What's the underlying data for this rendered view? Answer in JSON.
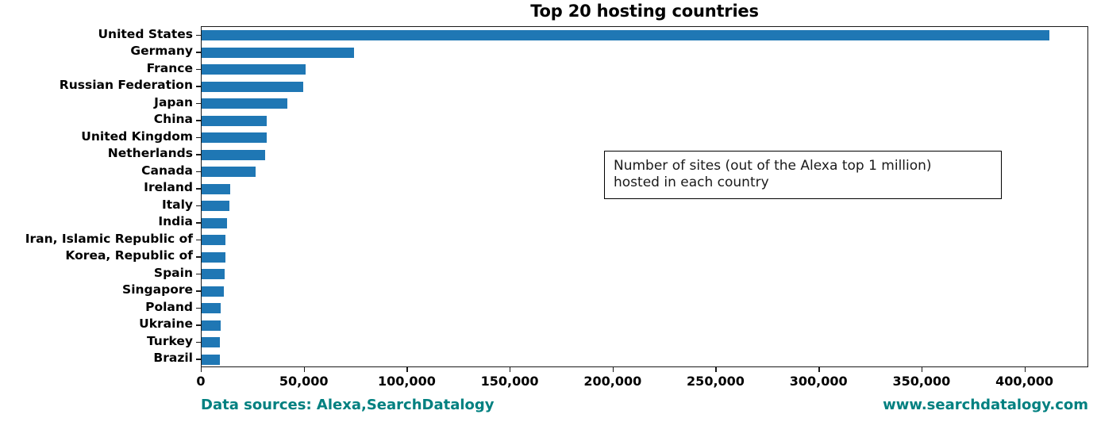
{
  "chart_data": {
    "type": "bar",
    "orientation": "horizontal",
    "title": "Top 20 hosting countries",
    "xlabel": "",
    "ylabel": "",
    "xlim": [
      0,
      431000
    ],
    "grid": false,
    "legend": null,
    "categories": [
      "United States",
      "Germany",
      "France",
      "Russian Federation",
      "Japan",
      "China",
      "United Kingdom",
      "Netherlands",
      "Canada",
      "Ireland",
      "Italy",
      "India",
      "Iran, Islamic Republic of",
      "Korea, Republic of",
      "Spain",
      "Singapore",
      "Poland",
      "Ukraine",
      "Turkey",
      "Brazil"
    ],
    "values": [
      411600,
      74000,
      50500,
      49300,
      41700,
      31600,
      31600,
      30800,
      26200,
      13900,
      13500,
      12300,
      11600,
      11600,
      11200,
      10800,
      9400,
      9300,
      9000,
      8900
    ],
    "xticks": [
      0,
      50000,
      100000,
      150000,
      200000,
      250000,
      300000,
      350000,
      400000
    ],
    "xticklabels": [
      "0",
      "50,000",
      "100,000",
      "150,000",
      "200,000",
      "250,000",
      "300,000",
      "350,000",
      "400,000"
    ],
    "bar_color": "#1f77b4",
    "annotation": {
      "line1": "Number of sites (out of the Alexa top 1 million)",
      "line2": "hosted in each country"
    }
  },
  "footer": {
    "sources": "Data sources: Alexa,SearchDatalogy",
    "website": "www.searchdatalogy.com",
    "color": "#008080"
  }
}
